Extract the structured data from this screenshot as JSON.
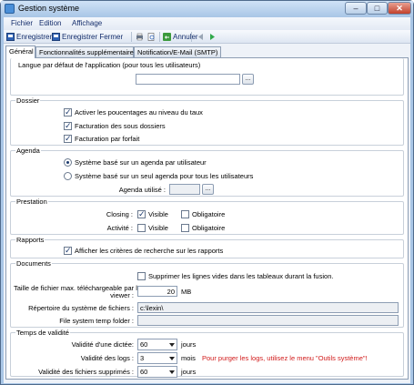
{
  "window": {
    "title": "Gestion système"
  },
  "menu": {
    "items": [
      "Fichier",
      "Edition",
      "Affichage"
    ]
  },
  "toolbar": {
    "save": "Enregistrer",
    "save_close": "Enregistrer Fermer",
    "cancel": "Annuler"
  },
  "tabs": [
    "Général",
    "Fonctionnalités supplémentaires",
    "Notification/E-Mail (SMTP)"
  ],
  "general": {
    "language_label": "Langue par défaut de l'application (pour tous les utilisateurs)",
    "language_value": "",
    "browse_label": "...",
    "dossier": {
      "title": "Dossier",
      "options": [
        {
          "label": "Activer les poucentages au niveau du taux",
          "checked": true
        },
        {
          "label": "Facturation des sous dossiers",
          "checked": true
        },
        {
          "label": "Facturation par forfait",
          "checked": true
        }
      ]
    },
    "agenda": {
      "title": "Agenda",
      "option1": "Système basé sur un agenda par utilisateur",
      "option2": "Système basé sur un seul agenda pour tous les utilisateurs",
      "used_label": "Agenda utilisé :",
      "used_value": ""
    },
    "prestation": {
      "title": "Prestation",
      "closing_label": "Closing :",
      "activite_label": "Activité :",
      "visible_label": "Visible",
      "obligatoire_label": "Obligatoire"
    },
    "rapports": {
      "title": "Rapports",
      "option": "Afficher les critères de recherche sur les rapports"
    },
    "documents": {
      "title": "Documents",
      "option": "Supprimer les lignes vides dans les tableaux durant la fusion.",
      "max_size_label_1": "Taille de fichier max. téléchargeable par le",
      "max_size_label_2": "viewer :",
      "max_size_value": "20",
      "max_size_unit": "MB",
      "repo_label": "Répertoire du système de fichiers :",
      "repo_value": "c:\\lexin\\",
      "temp_label": "File system temp folder :",
      "temp_value": ""
    },
    "validite": {
      "title": "Temps de validité",
      "dictee_label": "Validité d'une dictée:",
      "dictee_value": "60",
      "logs_label": "Validité des logs :",
      "logs_value": "3",
      "fichiers_label": "Validité des fichiers supprimés :",
      "fichiers_value": "60",
      "unit_days": "jours",
      "unit_months": "mois",
      "logs_note": "Pour purger les logs, utilisez le menu \"Outils système\"!",
      "note_color": "#d11a1a"
    }
  }
}
